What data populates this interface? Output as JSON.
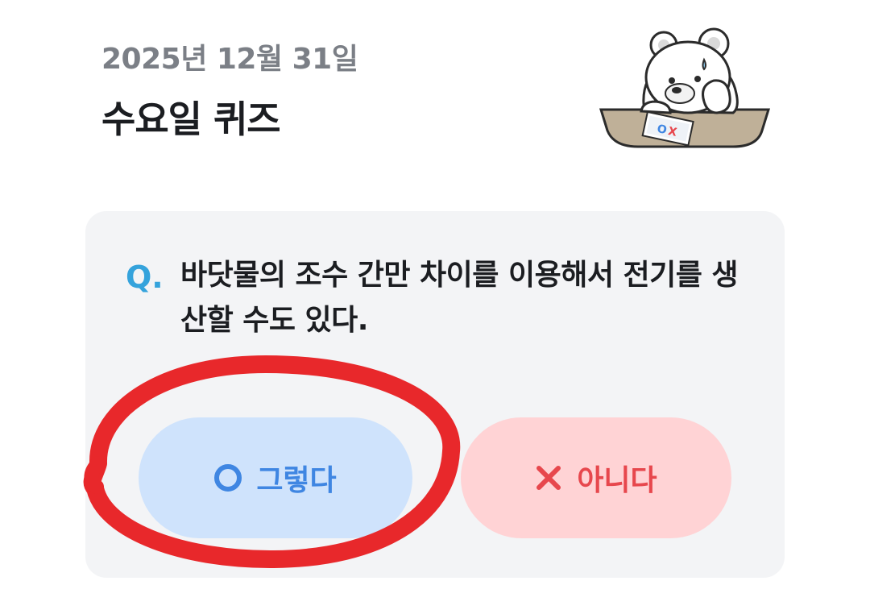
{
  "header": {
    "date": "2025년 12월 31일",
    "title": "수요일 퀴즈"
  },
  "quiz": {
    "q_mark": "Q.",
    "question": "바닷물의 조수 간만 차이를 이용해서 전기를 생산할 수도 있다."
  },
  "answers": {
    "yes_label": "그렇다",
    "no_label": "아니다",
    "yes_icon": "circle-o-icon",
    "no_icon": "x-cross-icon"
  },
  "mascot": {
    "paper_text": "OX",
    "icon": "polar-bear-mascot-icon"
  },
  "colors": {
    "yes_bg": "#cfe3fc",
    "yes_fg": "#3f86e2",
    "no_bg": "#ffd3d5",
    "no_fg": "#e7474d",
    "q_mark": "#35a3dc",
    "annotation_circle": "#e8282b"
  }
}
